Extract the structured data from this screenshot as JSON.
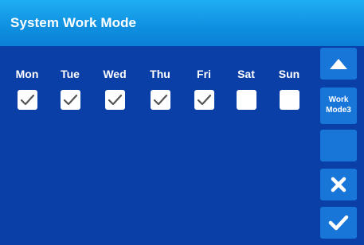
{
  "header": {
    "title": "System Work Mode"
  },
  "days": [
    {
      "label": "Mon",
      "checked": true
    },
    {
      "label": "Tue",
      "checked": true
    },
    {
      "label": "Wed",
      "checked": true
    },
    {
      "label": "Thu",
      "checked": true
    },
    {
      "label": "Fri",
      "checked": true
    },
    {
      "label": "Sat",
      "checked": false
    },
    {
      "label": "Sun",
      "checked": false
    }
  ],
  "side_panel": {
    "work_mode_line1": "Work",
    "work_mode_line2": "Mode3",
    "up_icon": "triangle-up-icon",
    "cancel_icon": "x-icon",
    "confirm_icon": "checkmark-icon"
  },
  "colors": {
    "background": "#0a3fa8",
    "header": "#1296e6",
    "side_button": "#1976d9",
    "text": "#ffffff"
  }
}
